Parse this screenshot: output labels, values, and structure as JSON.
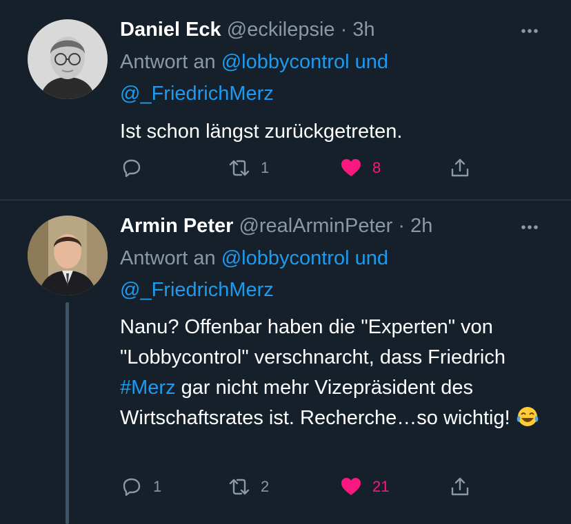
{
  "tweets": [
    {
      "author": "Daniel Eck",
      "handle": "@eckilepsie",
      "separator": "·",
      "time": "3h",
      "reply_prefix": "Antwort an",
      "reply_user1": "@lobbycontrol",
      "reply_conj": "und",
      "reply_user2": "@_FriedrichMerz",
      "text": "Ist schon längst zurückgetreten.",
      "replies": "",
      "retweets": "1",
      "likes": "8",
      "liked": true
    },
    {
      "author": "Armin Peter",
      "handle": "@realArminPeter",
      "separator": "·",
      "time": "2h",
      "reply_prefix": "Antwort an",
      "reply_user1": "@lobbycontrol",
      "reply_conj": "und",
      "reply_user2": "@_FriedrichMerz",
      "text_part1": "Nanu? Offenbar haben die \"Experten\" von \"Lobbycontrol\" verschnarcht, dass Friedrich ",
      "hashtag": "#Merz",
      "text_part2": " gar nicht mehr Vizepräsident des Wirtschaftsrates ist. Recherche…so wichtig!",
      "emoji": "face-with-tears-of-joy",
      "replies": "1",
      "retweets": "2",
      "likes": "21",
      "liked": true
    }
  ],
  "colors": {
    "background": "#15202b",
    "link": "#1d9bf0",
    "secondary_text": "#8b98a5",
    "like": "#f91880",
    "divider": "#38444d"
  },
  "icons": [
    "more-icon",
    "reply-icon",
    "retweet-icon",
    "heart-icon",
    "share-icon"
  ]
}
